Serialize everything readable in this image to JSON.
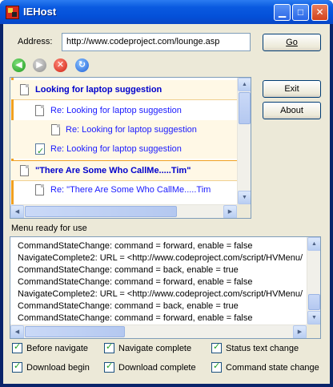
{
  "window": {
    "title": "IEHost"
  },
  "address": {
    "label": "Address:",
    "value": "http://www.codeproject.com/lounge.asp",
    "go_label": "Go"
  },
  "nav": {
    "icons": [
      "back-icon",
      "forward-icon",
      "stop-icon",
      "refresh-icon"
    ]
  },
  "side_buttons": {
    "exit_label": "Exit",
    "about_label": "About"
  },
  "tree": {
    "nodes": [
      {
        "text": "Looking for laptop suggestion"
      },
      {
        "text": "Re: Looking for laptop suggestion"
      },
      {
        "text": "Re: Looking for laptop suggestion"
      },
      {
        "text": "Re: Looking for laptop suggestion"
      },
      {
        "text": "\"There Are Some Who CallMe.....Tim\""
      },
      {
        "text": "Re: \"There Are Some Who CallMe.....Tim"
      }
    ]
  },
  "status": {
    "text": "Menu ready for use"
  },
  "log": {
    "lines": [
      "CommandStateChange: command = forward, enable = false",
      "NavigateComplete2: URL = <http://www.codeproject.com/script/HVMenu/",
      "CommandStateChange: command = back, enable = true",
      "CommandStateChange: command = forward, enable = false",
      "NavigateComplete2: URL = <http://www.codeproject.com/script/HVMenu/",
      "CommandStateChange: command = back, enable = true",
      "CommandStateChange: command = forward, enable = false"
    ]
  },
  "options": [
    {
      "label": "Before navigate",
      "checked": true
    },
    {
      "label": "Navigate complete",
      "checked": true
    },
    {
      "label": "Status text change",
      "checked": true
    },
    {
      "label": "Download begin",
      "checked": true
    },
    {
      "label": "Download complete",
      "checked": true
    },
    {
      "label": "Command state change",
      "checked": true
    }
  ],
  "colors": {
    "title_bar": "#0a5ae0",
    "dialog_bg": "#ece9d8",
    "link": "#1a1aff",
    "node_highlight": "#fff8e6",
    "node_accent": "#f0a020"
  }
}
